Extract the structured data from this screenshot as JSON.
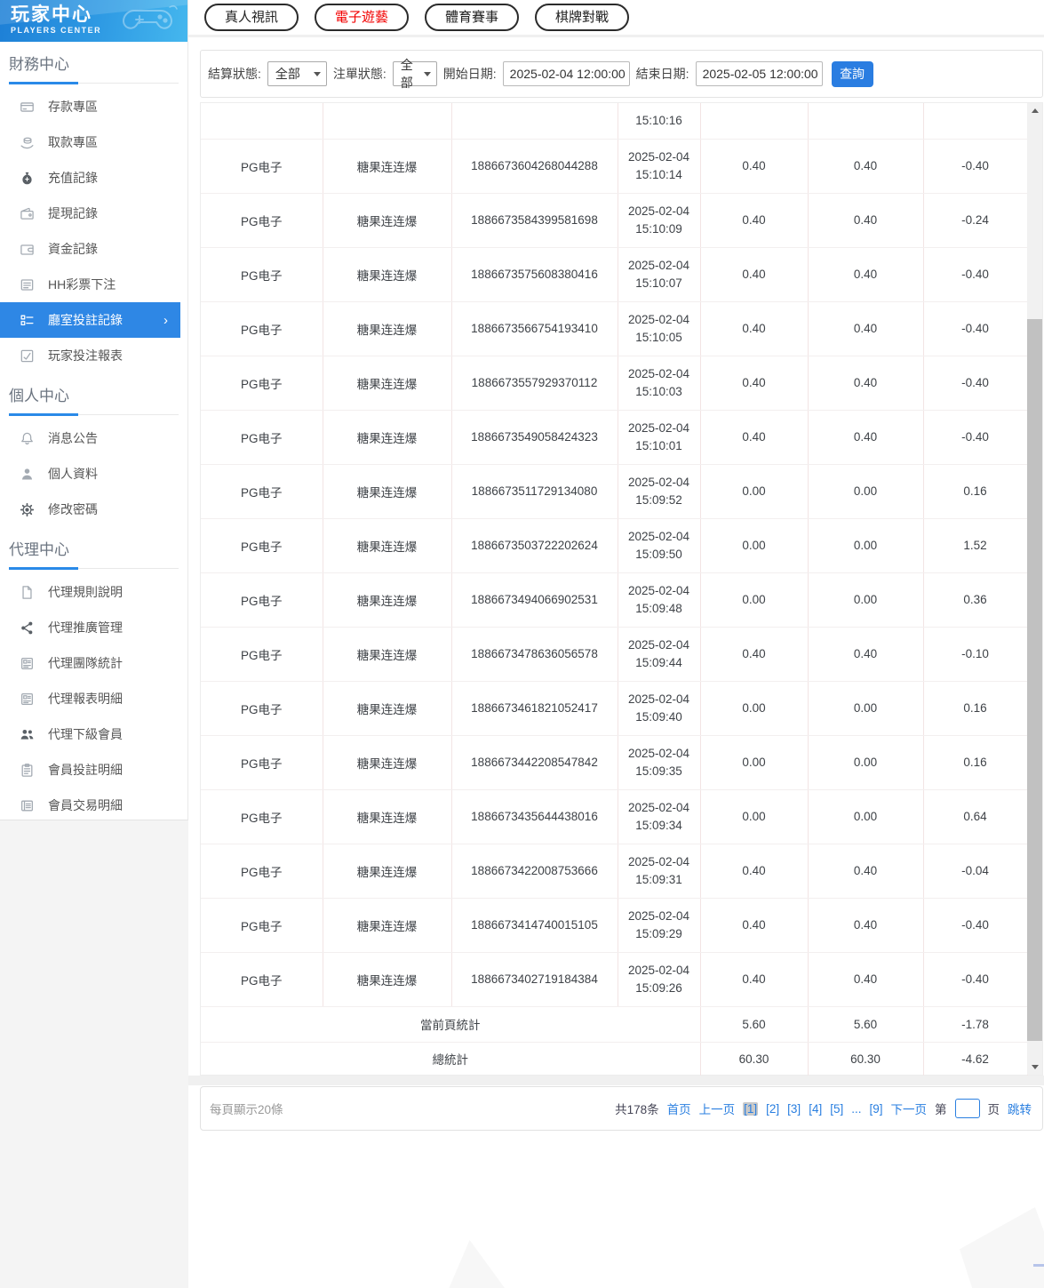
{
  "sidebar": {
    "title": "玩家中心",
    "subtitle": "PLAYERS CENTER",
    "sections": [
      {
        "header": "財務中心",
        "items": [
          {
            "label": "存款專區",
            "icon": "deposit-card"
          },
          {
            "label": "取款專區",
            "icon": "withdraw-hand"
          },
          {
            "label": "充值記錄",
            "icon": "money-bag"
          },
          {
            "label": "提現記錄",
            "icon": "withdrawal-wallet"
          },
          {
            "label": "資金記錄",
            "icon": "funds-wallet"
          },
          {
            "label": "HH彩票下注",
            "icon": "lottery-list"
          },
          {
            "label": "廳室投註記錄",
            "icon": "hall-list",
            "active": true
          },
          {
            "label": "玩家投注報表",
            "icon": "player-report"
          }
        ]
      },
      {
        "header": "個人中心",
        "items": [
          {
            "label": "消息公告",
            "icon": "bell"
          },
          {
            "label": "個人資料",
            "icon": "person"
          },
          {
            "label": "修改密碼",
            "icon": "gear"
          }
        ]
      },
      {
        "header": "代理中心",
        "items": [
          {
            "label": "代理規則說明",
            "icon": "doc"
          },
          {
            "label": "代理推廣管理",
            "icon": "share"
          },
          {
            "label": "代理團隊統計",
            "icon": "report-card"
          },
          {
            "label": "代理報表明細",
            "icon": "report-card"
          },
          {
            "label": "代理下級會員",
            "icon": "people"
          },
          {
            "label": "會員投註明細",
            "icon": "clipboard"
          },
          {
            "label": "會員交易明細",
            "icon": "listbox"
          }
        ]
      }
    ]
  },
  "tabs": [
    {
      "label": "真人視訊"
    },
    {
      "label": "電子遊藝",
      "red": true
    },
    {
      "label": "體育賽事"
    },
    {
      "label": "棋牌對戰"
    }
  ],
  "filters": {
    "settle_label": "結算狀態:",
    "settle_value": "全部",
    "order_label": "注單狀態:",
    "order_value": "全部",
    "start_label": "開始日期:",
    "start_value": "2025-02-04 12:00:00",
    "end_label": "結束日期:",
    "end_value": "2025-02-05 12:00:00",
    "search_label": "查詢"
  },
  "table": {
    "partial_row_time": "15:10:16",
    "rows": [
      {
        "provider": "PG电子",
        "game": "糖果连连爆",
        "order": "1886673604268044288",
        "date": "2025-02-04",
        "time": "15:10:14",
        "bet": "0.40",
        "valid": "0.40",
        "winloss": "-0.40"
      },
      {
        "provider": "PG电子",
        "game": "糖果连连爆",
        "order": "1886673584399581698",
        "date": "2025-02-04",
        "time": "15:10:09",
        "bet": "0.40",
        "valid": "0.40",
        "winloss": "-0.24"
      },
      {
        "provider": "PG电子",
        "game": "糖果连连爆",
        "order": "1886673575608380416",
        "date": "2025-02-04",
        "time": "15:10:07",
        "bet": "0.40",
        "valid": "0.40",
        "winloss": "-0.40"
      },
      {
        "provider": "PG电子",
        "game": "糖果连连爆",
        "order": "1886673566754193410",
        "date": "2025-02-04",
        "time": "15:10:05",
        "bet": "0.40",
        "valid": "0.40",
        "winloss": "-0.40"
      },
      {
        "provider": "PG电子",
        "game": "糖果连连爆",
        "order": "1886673557929370112",
        "date": "2025-02-04",
        "time": "15:10:03",
        "bet": "0.40",
        "valid": "0.40",
        "winloss": "-0.40"
      },
      {
        "provider": "PG电子",
        "game": "糖果连连爆",
        "order": "1886673549058424323",
        "date": "2025-02-04",
        "time": "15:10:01",
        "bet": "0.40",
        "valid": "0.40",
        "winloss": "-0.40"
      },
      {
        "provider": "PG电子",
        "game": "糖果连连爆",
        "order": "1886673511729134080",
        "date": "2025-02-04",
        "time": "15:09:52",
        "bet": "0.00",
        "valid": "0.00",
        "winloss": "0.16"
      },
      {
        "provider": "PG电子",
        "game": "糖果连连爆",
        "order": "1886673503722202624",
        "date": "2025-02-04",
        "time": "15:09:50",
        "bet": "0.00",
        "valid": "0.00",
        "winloss": "1.52"
      },
      {
        "provider": "PG电子",
        "game": "糖果连连爆",
        "order": "1886673494066902531",
        "date": "2025-02-04",
        "time": "15:09:48",
        "bet": "0.00",
        "valid": "0.00",
        "winloss": "0.36"
      },
      {
        "provider": "PG电子",
        "game": "糖果连连爆",
        "order": "1886673478636056578",
        "date": "2025-02-04",
        "time": "15:09:44",
        "bet": "0.40",
        "valid": "0.40",
        "winloss": "-0.10"
      },
      {
        "provider": "PG电子",
        "game": "糖果连连爆",
        "order": "1886673461821052417",
        "date": "2025-02-04",
        "time": "15:09:40",
        "bet": "0.00",
        "valid": "0.00",
        "winloss": "0.16"
      },
      {
        "provider": "PG电子",
        "game": "糖果连连爆",
        "order": "1886673442208547842",
        "date": "2025-02-04",
        "time": "15:09:35",
        "bet": "0.00",
        "valid": "0.00",
        "winloss": "0.16"
      },
      {
        "provider": "PG电子",
        "game": "糖果连连爆",
        "order": "1886673435644438016",
        "date": "2025-02-04",
        "time": "15:09:34",
        "bet": "0.00",
        "valid": "0.00",
        "winloss": "0.64"
      },
      {
        "provider": "PG电子",
        "game": "糖果连连爆",
        "order": "1886673422008753666",
        "date": "2025-02-04",
        "time": "15:09:31",
        "bet": "0.40",
        "valid": "0.40",
        "winloss": "-0.04"
      },
      {
        "provider": "PG电子",
        "game": "糖果连连爆",
        "order": "1886673414740015105",
        "date": "2025-02-04",
        "time": "15:09:29",
        "bet": "0.40",
        "valid": "0.40",
        "winloss": "-0.40"
      },
      {
        "provider": "PG电子",
        "game": "糖果连连爆",
        "order": "1886673402719184384",
        "date": "2025-02-04",
        "time": "15:09:26",
        "bet": "0.40",
        "valid": "0.40",
        "winloss": "-0.40"
      }
    ],
    "summary": [
      {
        "label": "當前頁統計",
        "bet": "5.60",
        "valid": "5.60",
        "winloss": "-1.78"
      },
      {
        "label": "總統計",
        "bet": "60.30",
        "valid": "60.30",
        "winloss": "-4.62"
      }
    ]
  },
  "pagination": {
    "per_page_text": "每頁顯示20條",
    "total_text": "共178条",
    "first": "首页",
    "prev": "上一页",
    "pages": [
      {
        "label": "[1]",
        "current": true
      },
      {
        "label": "[2]"
      },
      {
        "label": "[3]"
      },
      {
        "label": "[4]"
      },
      {
        "label": "[5]"
      },
      {
        "label": "..."
      },
      {
        "label": "[9]"
      }
    ],
    "next": "下一页",
    "jump_prefix": "第",
    "jump_suffix": "页",
    "jump_label": "跳转",
    "jump_value": ""
  },
  "colors": {
    "accent_blue": "#2e87e5",
    "link_blue": "#2a7fe0",
    "tab_red": "#f20000",
    "header_gradient_start": "#1d7fd6",
    "header_gradient_end": "#45b7ee"
  }
}
